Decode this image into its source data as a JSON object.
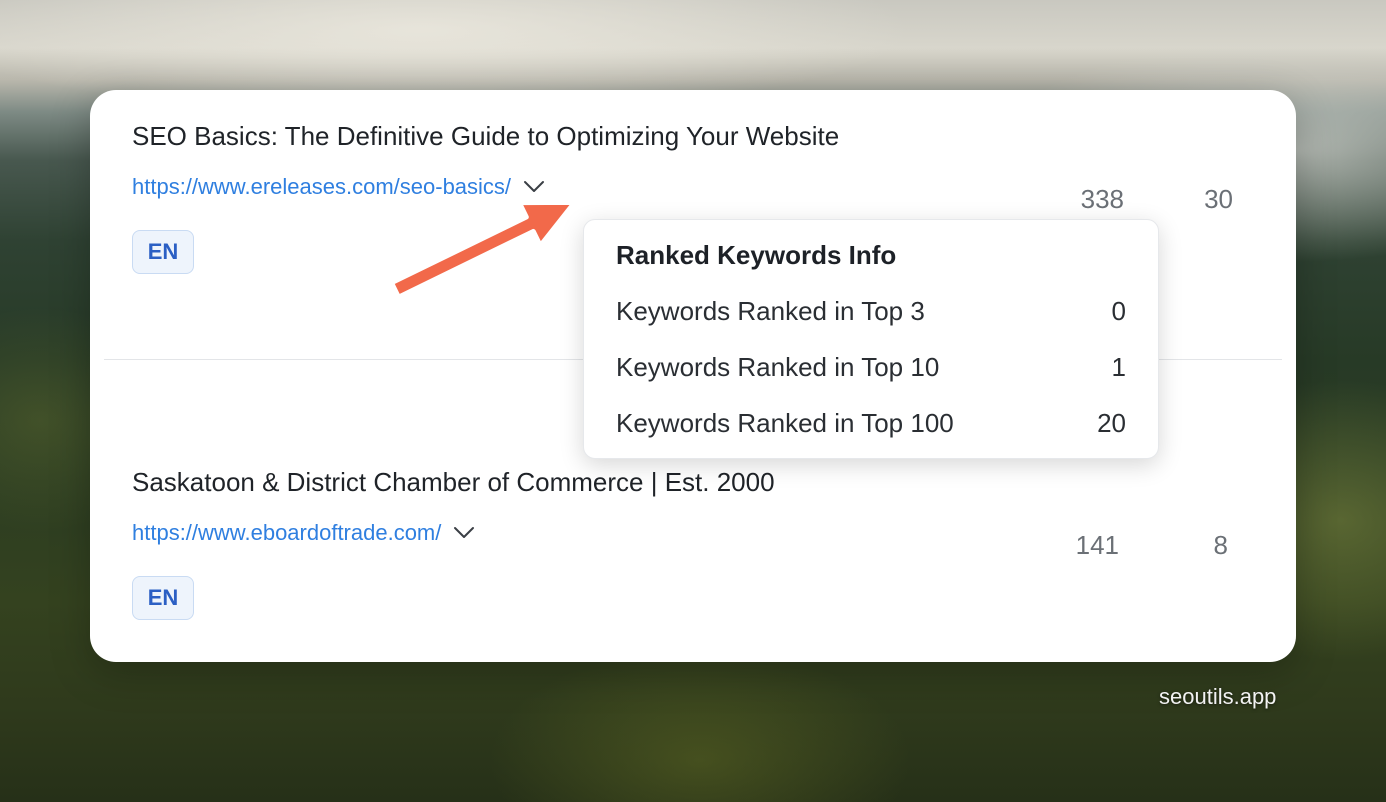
{
  "rows": [
    {
      "title": "SEO Basics: The Definitive Guide to Optimizing Your Website",
      "url": "https://www.ereleases.com/seo-basics/",
      "language": "EN",
      "metric_a": "338",
      "metric_b": "30"
    },
    {
      "title": "Saskatoon & District Chamber of Commerce | Est. 2000",
      "url": "https://www.eboardoftrade.com/",
      "language": "EN",
      "metric_a": "141",
      "metric_b": "8"
    }
  ],
  "popover": {
    "title": "Ranked Keywords Info",
    "items": [
      {
        "label": "Keywords Ranked in Top 3",
        "value": "0"
      },
      {
        "label": "Keywords Ranked in Top 10",
        "value": "1"
      },
      {
        "label": "Keywords Ranked in Top 100",
        "value": "20"
      }
    ]
  },
  "watermark": "seoutils.app",
  "icons": {
    "expand": "chevron-down-icon",
    "annotation": "arrow-annotation-icon"
  },
  "colors": {
    "link": "#2f7fe0",
    "badge_text": "#2b5fc4",
    "badge_bg": "#eef4fc",
    "arrow": "#f2694a",
    "metric_text": "#6b7076"
  }
}
